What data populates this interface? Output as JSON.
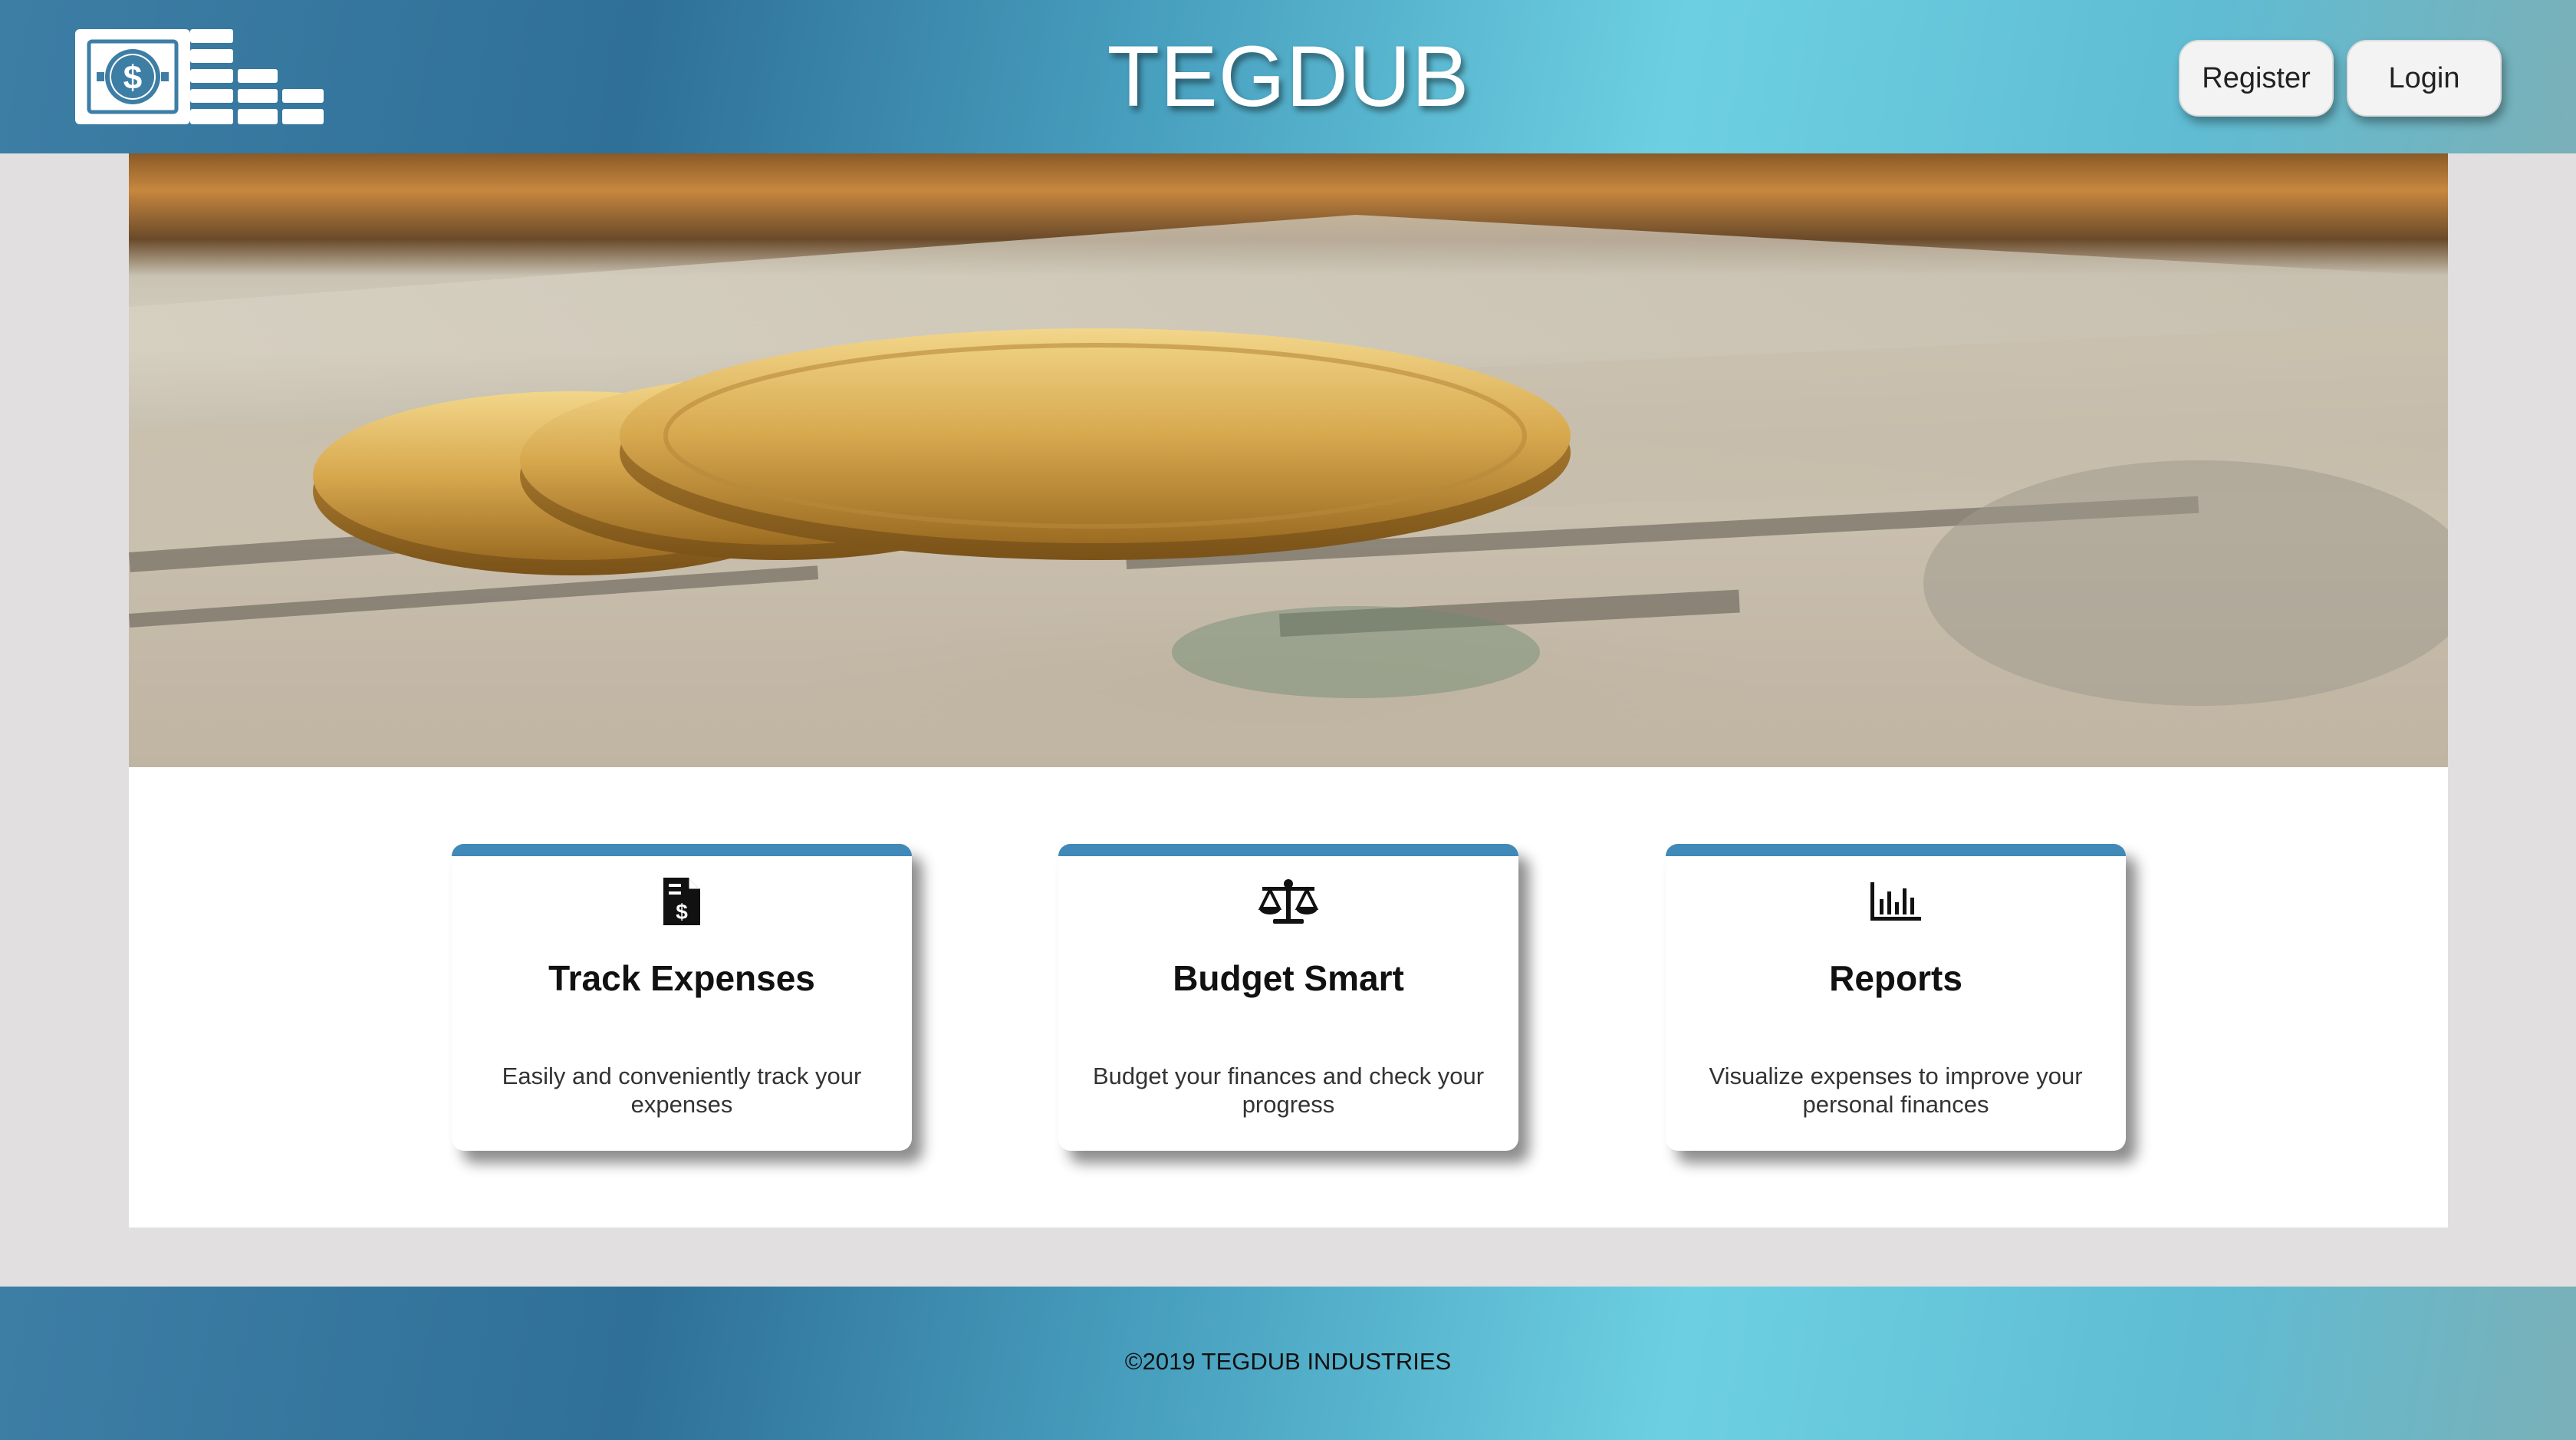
{
  "header": {
    "title": "TEGDUB",
    "register_label": "Register",
    "login_label": "Login",
    "logo_icon": "money-stack-logo-icon"
  },
  "hero": {
    "image": "gold-coins-on-dollar-bills-photo"
  },
  "features": [
    {
      "icon": "invoice-dollar-icon",
      "title": "Track Expenses",
      "description": "Easily and conveniently track your expenses"
    },
    {
      "icon": "balance-scale-icon",
      "title": "Budget Smart",
      "description": "Budget your finances and check your progress"
    },
    {
      "icon": "bar-chart-icon",
      "title": "Reports",
      "description": "Visualize expenses to improve your personal finances"
    }
  ],
  "footer": {
    "copyright": "©2019 TEGDUB INDUSTRIES"
  },
  "colors": {
    "accent": "#4189b8",
    "header_gradient_dark": "#2f7098",
    "header_gradient_light": "#6dd0e2",
    "page_background": "#e1dfe0"
  }
}
